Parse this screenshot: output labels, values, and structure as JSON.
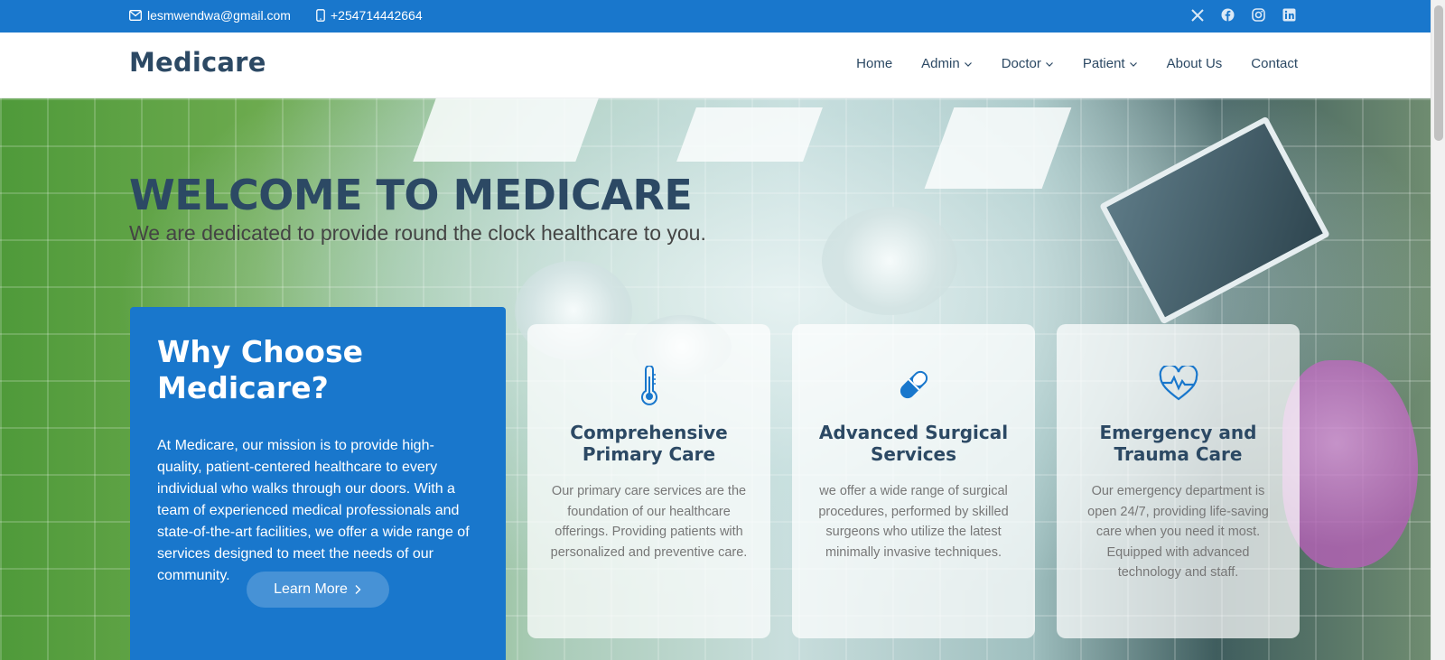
{
  "topbar": {
    "email": "lesmwendwa@gmail.com",
    "phone": "+254714442664",
    "socials": [
      "x-icon",
      "facebook-icon",
      "instagram-icon",
      "linkedin-icon"
    ]
  },
  "header": {
    "logo": "Medicare",
    "nav": [
      {
        "label": "Home",
        "dropdown": false
      },
      {
        "label": "Admin",
        "dropdown": true
      },
      {
        "label": "Doctor",
        "dropdown": true
      },
      {
        "label": "Patient",
        "dropdown": true
      },
      {
        "label": "About Us",
        "dropdown": false
      },
      {
        "label": "Contact",
        "dropdown": false
      }
    ]
  },
  "hero": {
    "title": "WELCOME TO MEDICARE",
    "subtitle": "We are dedicated to provide round the clock healthcare to you."
  },
  "why": {
    "title": "Why Choose Medicare?",
    "body": "At Medicare, our mission is to provide high-quality, patient-centered healthcare to every individual who walks through our doors. With a team of experienced medical professionals and state-of-the-art facilities, we offer a wide range of services designed to meet the needs of our community.",
    "button": "Learn More"
  },
  "cards": [
    {
      "icon": "thermometer-icon",
      "title": "Comprehensive Primary Care",
      "body": "Our primary care services are the foundation of our healthcare offerings. Providing patients with personalized and preventive care."
    },
    {
      "icon": "capsule-icon",
      "title": "Advanced Surgical Services",
      "body": "we offer a wide range of surgical procedures, performed by skilled surgeons who utilize the latest minimally invasive techniques."
    },
    {
      "icon": "heart-pulse-icon",
      "title": "Emergency and Trauma Care",
      "body": "Our emergency department is open 24/7, providing life-saving care when you need it most. Equipped with advanced technology and staff."
    }
  ],
  "colors": {
    "primary": "#1977cc",
    "heading": "#2c4964",
    "text": "#777777"
  }
}
